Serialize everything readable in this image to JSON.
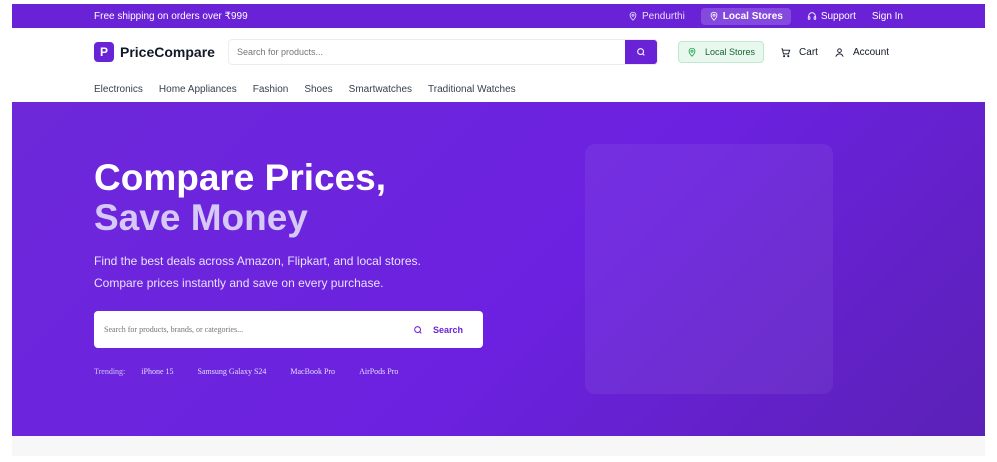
{
  "topbar": {
    "promo": "Free shipping on orders over ₹999",
    "location": "Pendurthi",
    "local_stores": "Local Stores",
    "support": "Support",
    "sign_in": "Sign In"
  },
  "header": {
    "logo_letter": "P",
    "brand": "PriceCompare",
    "search_placeholder": "Search for products...",
    "local_stores": "Local Stores",
    "cart": "Cart",
    "account": "Account"
  },
  "categories": [
    "Electronics",
    "Home Appliances",
    "Fashion",
    "Shoes",
    "Smartwatches",
    "Traditional Watches"
  ],
  "hero": {
    "title_line1": "Compare Prices,",
    "title_line2": "Save Money",
    "subtitle_line1": "Find the best deals across Amazon, Flipkart, and local stores.",
    "subtitle_line2": "Compare prices instantly and save on every purchase.",
    "search_placeholder": "Search for products, brands, or categories...",
    "search_button": "Search",
    "trending_label": "Trending:",
    "trending": [
      "iPhone 15",
      "Samsung Galaxy S24",
      "MacBook Pro",
      "AirPods Pro"
    ]
  },
  "colors": {
    "brand_purple": "#6a22d6",
    "local_green_bg": "#e8f8ee"
  },
  "icons": {
    "location": "map-pin-icon",
    "support": "headphones-icon",
    "search": "search-icon",
    "cart": "cart-icon",
    "account": "user-icon"
  }
}
